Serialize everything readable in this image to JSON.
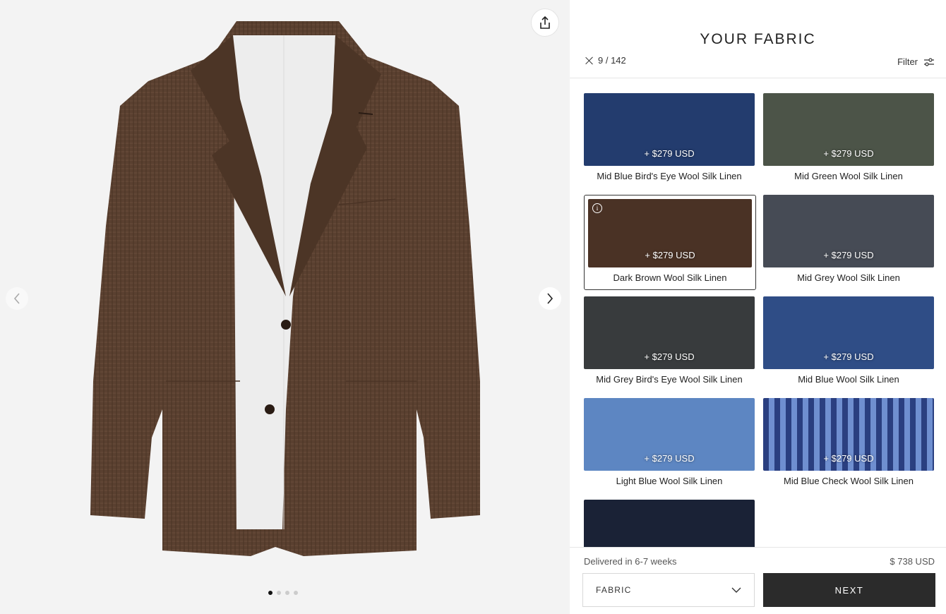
{
  "preview": {
    "share_icon": "share-icon",
    "prev_icon": "chevron-left-icon",
    "next_icon": "chevron-right-icon",
    "dots": [
      true,
      false,
      false,
      false
    ],
    "jacket_color": "#5a4030"
  },
  "panel": {
    "title": "YOUR FABRIC",
    "count": "9 / 142",
    "filter_label": "Filter"
  },
  "fabrics": [
    {
      "name": "Mid Blue Bird's Eye Wool Silk Linen",
      "price": "+ $279 USD",
      "color": "#233c6e",
      "selected": false
    },
    {
      "name": "Mid Green Wool Silk Linen",
      "price": "+ $279 USD",
      "color": "#4c5448",
      "selected": false
    },
    {
      "name": "Dark Brown Wool Silk Linen",
      "price": "+ $279 USD",
      "color": "#4a3225",
      "selected": true
    },
    {
      "name": "Mid Grey Wool Silk Linen",
      "price": "+ $279 USD",
      "color": "#464b55",
      "selected": false
    },
    {
      "name": "Mid Grey Bird's Eye Wool Silk Linen",
      "price": "+ $279 USD",
      "color": "#383b3d",
      "selected": false
    },
    {
      "name": "Mid Blue Wool Silk Linen",
      "price": "+ $279 USD",
      "color": "#2f4d86",
      "selected": false
    },
    {
      "name": "Light Blue Wool Silk Linen",
      "price": "+ $279 USD",
      "color": "#5d86c2",
      "selected": false
    },
    {
      "name": "Mid Blue Check Wool Silk Linen",
      "price": "+ $279 USD",
      "color": "#334d94",
      "selected": false
    },
    {
      "name": "",
      "price": "",
      "color": "#1a2236",
      "selected": false
    }
  ],
  "footer": {
    "delivery": "Delivered in 6-7 weeks",
    "total": "$ 738 USD",
    "select_label": "FABRIC",
    "next_label": "NEXT"
  }
}
